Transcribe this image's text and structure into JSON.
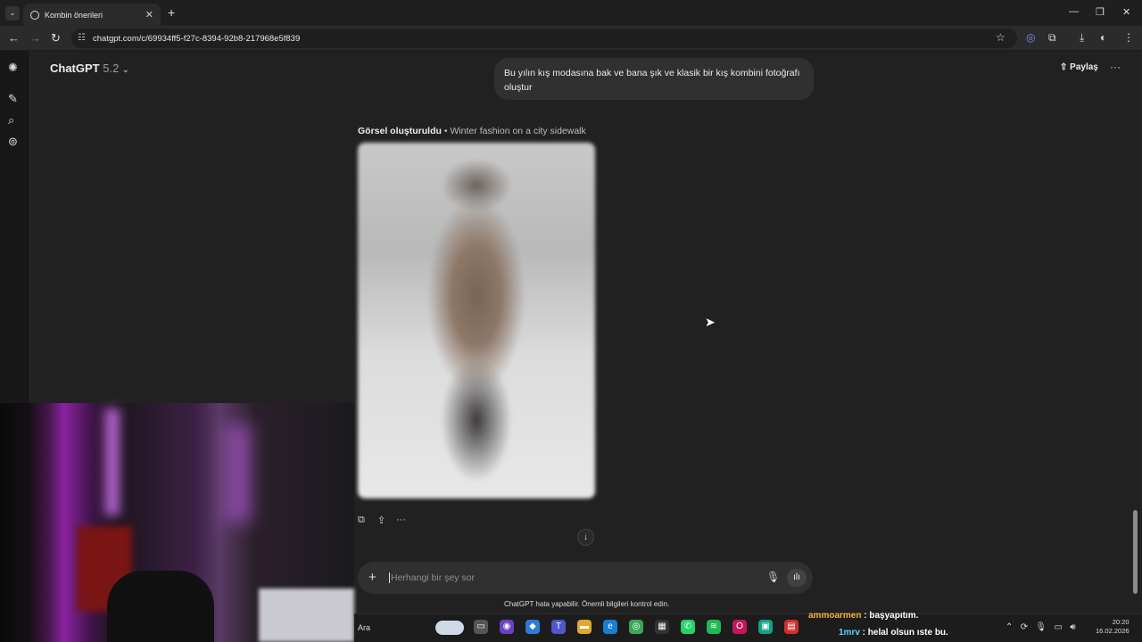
{
  "browser": {
    "tab_title": "Kombin önerileri",
    "url": "chatgpt.com/c/69934ff5-f27c-8394-92b8-217968e5f839"
  },
  "header": {
    "model_name": "ChatGPT",
    "model_version": "5.2",
    "share_label": "Paylaş"
  },
  "conversation": {
    "user_message": "Bu yılın kış modasına bak ve bana şık ve klasik bir kış kombini fotoğrafı oluştur",
    "generated_label": "Görsel oluşturuldu",
    "generated_separator": " • ",
    "generated_subtitle": "Winter fashion on a city sidewalk"
  },
  "composer": {
    "placeholder": "Herhangi bir şey sor",
    "disclaimer": "ChatGPT hata yapabilir. Önemli bilgileri kontrol edin."
  },
  "taskbar": {
    "search_label": "Ara",
    "time": "20:20",
    "date": "16.02.2026"
  },
  "stream_chat": [
    {
      "user": "ammoarmen",
      "message": " : başyapıtım."
    },
    {
      "user": "1mrv",
      "message": " : helal olsun ıste bu."
    }
  ],
  "colors": {
    "app_background": "#212121",
    "bubble": "#303030",
    "composer": "#303030"
  }
}
